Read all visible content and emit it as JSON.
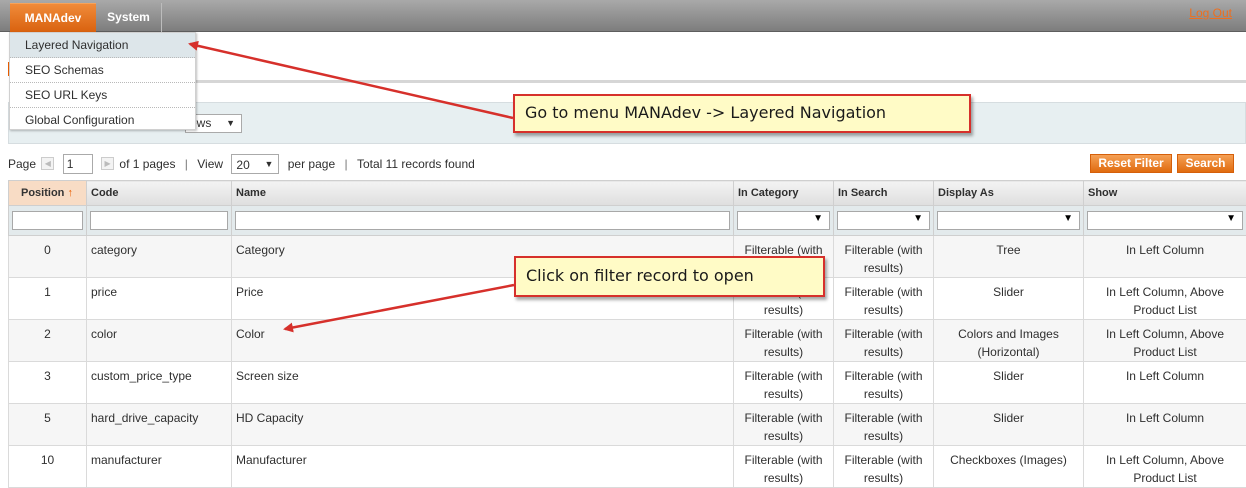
{
  "nav": {
    "items": [
      "MANAdev",
      "System"
    ],
    "logout": "Log Out"
  },
  "dropdown": {
    "items": [
      "Layered Navigation",
      "SEO Schemas",
      "SEO URL Keys",
      "Global Configuration"
    ]
  },
  "view_select_fragment": "ews",
  "pager": {
    "page_label": "Page",
    "page_value": "1",
    "of_pages": "of 1 pages",
    "view_label": "View",
    "per_page_value": "20",
    "per_page_label": "per page",
    "total": "Total 11 records found"
  },
  "buttons": {
    "reset": "Reset Filter",
    "search": "Search"
  },
  "columns": [
    "Position",
    "Code",
    "Name",
    "In Category",
    "In Search",
    "Display As",
    "Show"
  ],
  "sort_indicator": "↑",
  "rows": [
    {
      "position": "0",
      "code": "category",
      "name": "Category",
      "in_category": "Filterable (with results)",
      "in_search": "Filterable (with results)",
      "display_as": "Tree",
      "show": "In Left Column"
    },
    {
      "position": "1",
      "code": "price",
      "name": "Price",
      "in_category": "Filterable (with results)",
      "in_search": "Filterable (with results)",
      "display_as": "Slider",
      "show": "In Left Column, Above Product List"
    },
    {
      "position": "2",
      "code": "color",
      "name": "Color",
      "in_category": "Filterable (with results)",
      "in_search": "Filterable (with results)",
      "display_as": "Colors and Images (Horizontal)",
      "show": "In Left Column, Above Product List"
    },
    {
      "position": "3",
      "code": "custom_price_type",
      "name": "Screen size",
      "in_category": "Filterable (with results)",
      "in_search": "Filterable (with results)",
      "display_as": "Slider",
      "show": "In Left Column"
    },
    {
      "position": "5",
      "code": "hard_drive_capacity",
      "name": "HD Capacity",
      "in_category": "Filterable (with results)",
      "in_search": "Filterable (with results)",
      "display_as": "Slider",
      "show": "In Left Column"
    },
    {
      "position": "10",
      "code": "manufacturer",
      "name": "Manufacturer",
      "in_category": "Filterable (with results)",
      "in_search": "Filterable (with results)",
      "display_as": "Checkboxes (Images)",
      "show": "In Left Column, Above Product List"
    }
  ],
  "callouts": {
    "menu": "Go to menu MANAdev -> Layered Navigation",
    "record": "Click on filter record to open"
  },
  "colors": {
    "accent": "#eb5e00",
    "callout_border": "#d6302b",
    "callout_bg": "#fffbc6"
  }
}
